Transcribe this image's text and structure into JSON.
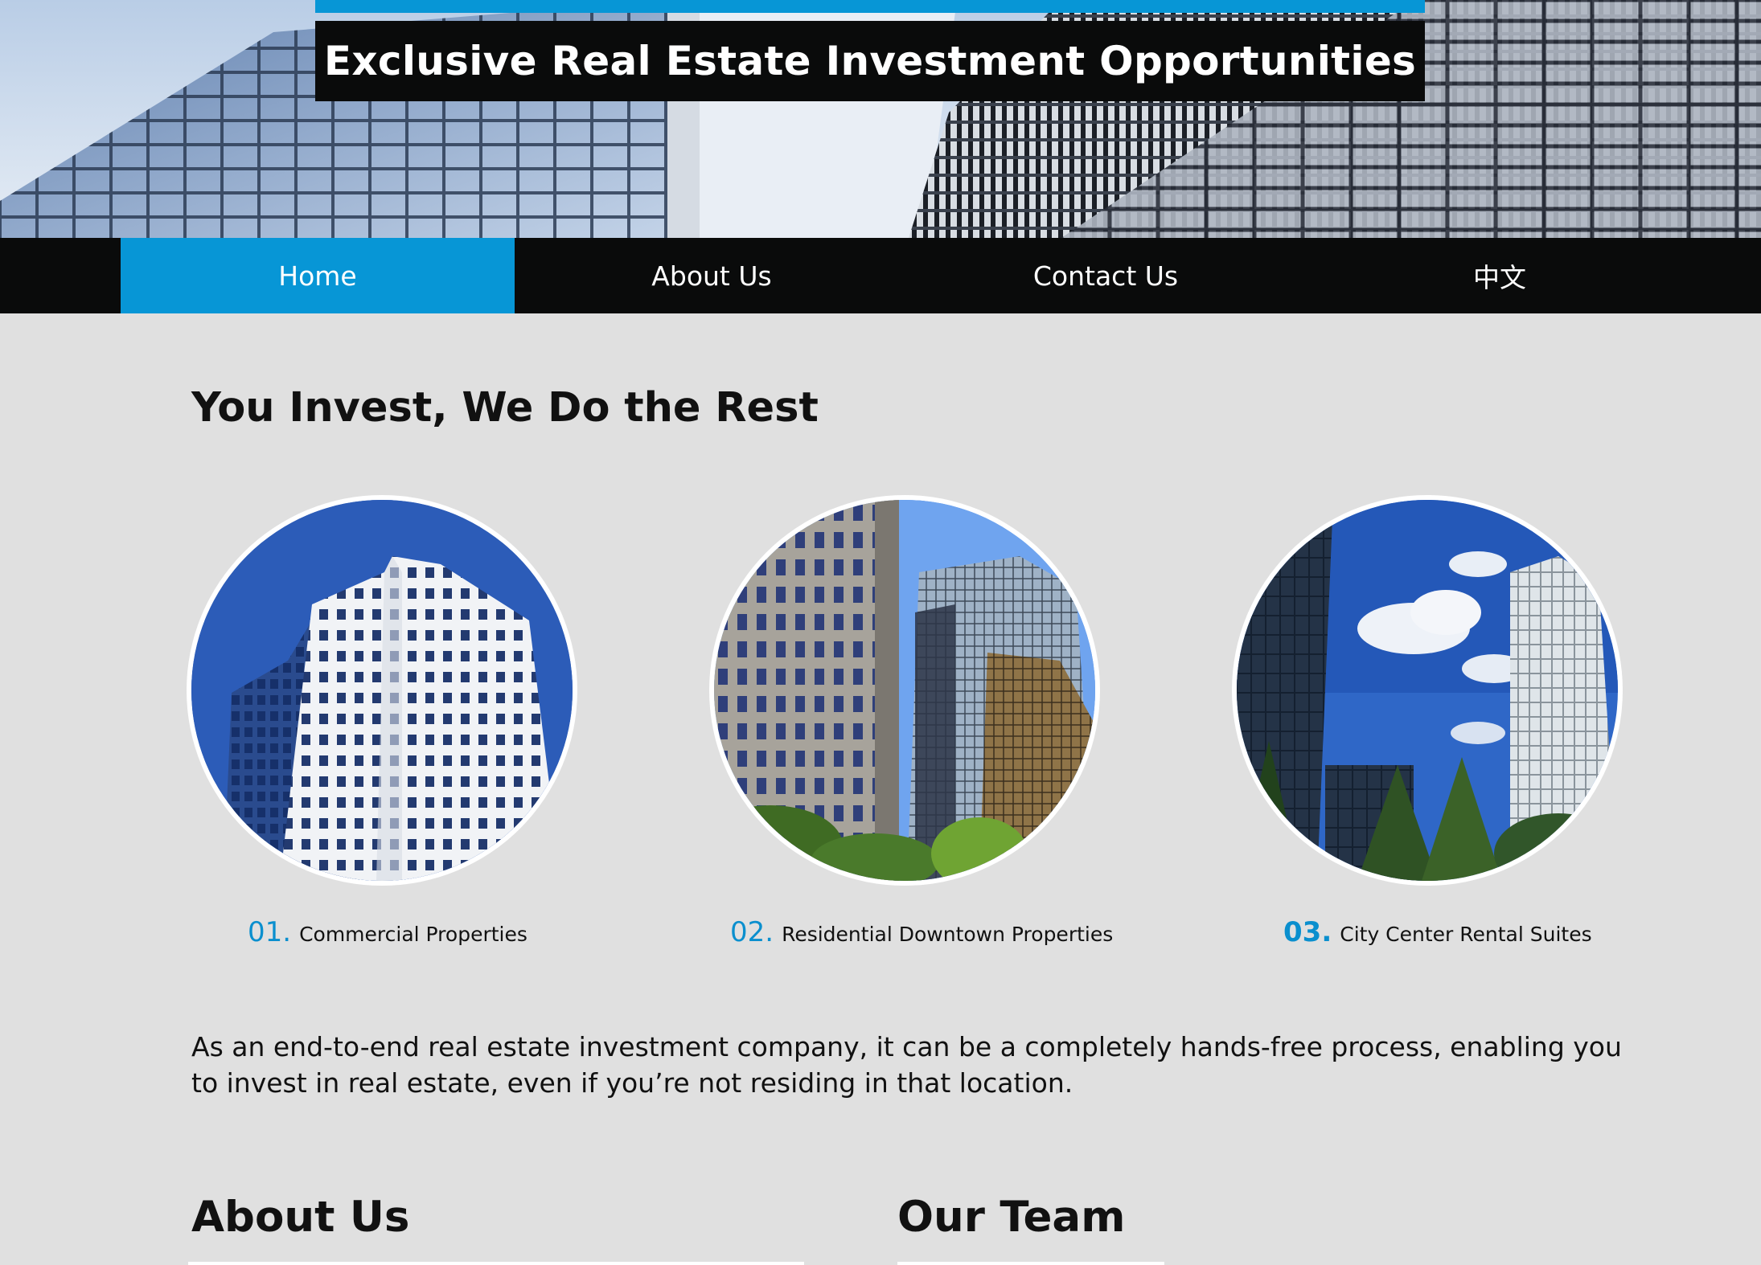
{
  "header": {
    "title": "Exclusive Real Estate Investment Opportunities"
  },
  "nav": {
    "items": [
      {
        "label": "Home",
        "active": true
      },
      {
        "label": "About Us",
        "active": false
      },
      {
        "label": "Contact Us",
        "active": false
      },
      {
        "label": "中文",
        "active": false
      }
    ]
  },
  "main": {
    "heading": "You Invest, We Do the Rest",
    "properties": [
      {
        "number": "01.",
        "label": "Commercial Properties"
      },
      {
        "number": "02.",
        "label": "Residential Downtown Properties"
      },
      {
        "number": "03.",
        "label": "City Center Rental Suites"
      }
    ],
    "paragraph": "As an end-to-end real estate investment company, it can be a completely hands-free process, enabling you to invest in real estate, even if you’re not residing in that location."
  },
  "sections": {
    "about_heading": "About Us",
    "team_heading": "Our Team"
  },
  "colors": {
    "accent": "#0796d6",
    "nav_background": "#0a0b0b",
    "page_background": "#e0e0e0"
  }
}
